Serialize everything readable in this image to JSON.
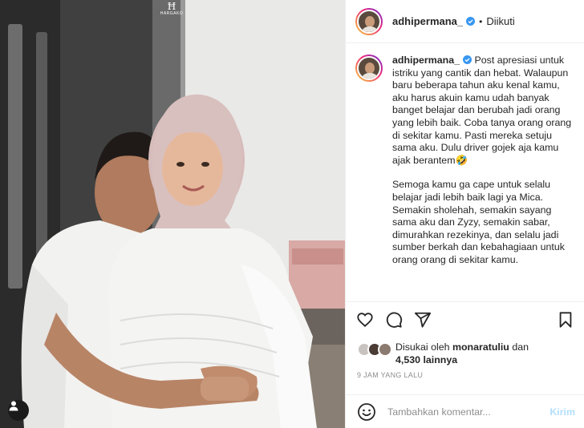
{
  "photo": {
    "watermark_text": "HARGAKO",
    "alt": "couple photo"
  },
  "header": {
    "username": "adhipermana_",
    "separator": "•",
    "follow_status": "Diikuti"
  },
  "caption": {
    "username": "adhipermana_",
    "paragraph1": "Post apresiasi untuk istriku yang cantik dan hebat. Walaupun baru beberapa tahun aku kenal kamu, aku harus akuin kamu udah banyak banget belajar dan berubah jadi orang yang lebih baik. Coba tanya orang orang di sekitar kamu. Pasti mereka setuju sama aku. Dulu driver gojek aja kamu ajak berantem🤣",
    "paragraph2": "Semoga kamu ga cape untuk selalu belajar jadi lebih baik lagi ya Mica. Semakin sholehah, semakin sayang sama aku dan Zyzy, semakin sabar, dimurahkan rezekinya, dan selalu jadi sumber berkah dan kebahagiaan untuk orang orang di sekitar kamu."
  },
  "likes": {
    "prefix": "Disukai oleh",
    "liker": "monaratuliu",
    "connector": "dan",
    "others": "4,530 lainnya"
  },
  "timestamp": "9 JAM YANG LALU",
  "comment": {
    "placeholder": "Tambahkan komentar...",
    "post_label": "Kirim"
  },
  "icons": {
    "like": "heart-icon",
    "comment": "comment-icon",
    "share": "share-icon",
    "save": "bookmark-icon",
    "emoji": "emoji-icon",
    "tag": "user-tag-icon"
  },
  "colors": {
    "verified": "#3897f0",
    "post_disabled": "#b2dffc",
    "muted": "#8e8e8e",
    "border": "#efefef"
  }
}
